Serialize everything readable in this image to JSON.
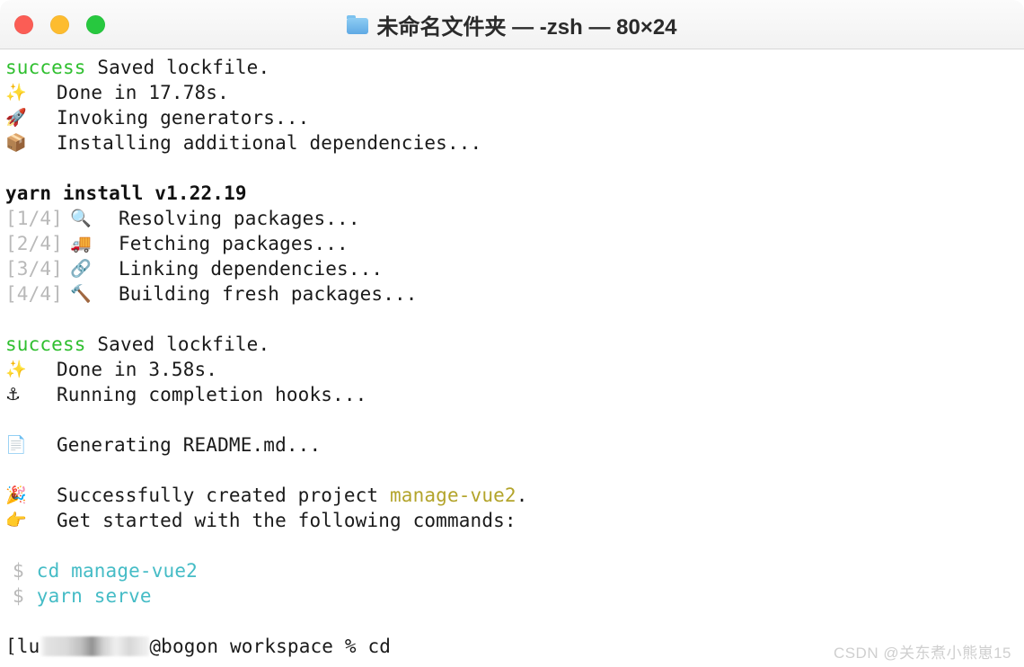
{
  "window": {
    "title": "未命名文件夹 — -zsh — 80×24",
    "folder_icon": "folder-icon",
    "controls": [
      {
        "name": "close",
        "color": "#fb5d55"
      },
      {
        "name": "minimize",
        "color": "#fdbc2f"
      },
      {
        "name": "zoom",
        "color": "#27c83f"
      }
    ]
  },
  "terminal": {
    "lines": [
      {
        "type": "status",
        "status": "success",
        "text": " Saved lockfile."
      },
      {
        "type": "emoji",
        "icon": "✨",
        "text": "Done in 17.78s."
      },
      {
        "type": "emoji",
        "icon": "🚀",
        "text": "Invoking generators..."
      },
      {
        "type": "emoji",
        "icon": "📦",
        "text": "Installing additional dependencies..."
      },
      {
        "type": "blank"
      },
      {
        "type": "bold",
        "text": "yarn install v1.22.19"
      },
      {
        "type": "step",
        "step": "[1/4]",
        "icon": "🔍",
        "text": "Resolving packages..."
      },
      {
        "type": "step",
        "step": "[2/4]",
        "icon": "🚚",
        "text": "Fetching packages..."
      },
      {
        "type": "step",
        "step": "[3/4]",
        "icon": "🔗",
        "text": "Linking dependencies..."
      },
      {
        "type": "step",
        "step": "[4/4]",
        "icon": "🔨",
        "text": "Building fresh packages..."
      },
      {
        "type": "blank"
      },
      {
        "type": "status",
        "status": "success",
        "text": " Saved lockfile."
      },
      {
        "type": "emoji",
        "icon": "✨",
        "text": "Done in 3.58s."
      },
      {
        "type": "emoji",
        "icon": "⚓",
        "text": "Running completion hooks..."
      },
      {
        "type": "blank"
      },
      {
        "type": "emoji",
        "icon": "📄",
        "text": "Generating README.md..."
      },
      {
        "type": "blank"
      },
      {
        "type": "emoji-mixed",
        "icon": "🎉",
        "pre": "Successfully created project ",
        "highlight": "manage-vue2",
        "post": "."
      },
      {
        "type": "emoji",
        "icon": "👉",
        "text": "Get started with the following commands:"
      },
      {
        "type": "blank"
      },
      {
        "type": "command",
        "prompt": "$",
        "text": "cd manage-vue2"
      },
      {
        "type": "command",
        "prompt": "$",
        "text": "yarn serve"
      },
      {
        "type": "blank"
      },
      {
        "type": "prompt",
        "prefix": "[lu",
        "redacted": true,
        "suffix": "@bogon workspace % cd"
      }
    ],
    "colors": {
      "success": "#2fbf2f",
      "dim": "#b9b9b9",
      "cyan": "#45bcc6",
      "project": "#b3a42b",
      "text": "#1a1a1a",
      "background": "#ffffff"
    }
  },
  "watermark": {
    "text": "CSDN @关东煮小熊崽15"
  }
}
